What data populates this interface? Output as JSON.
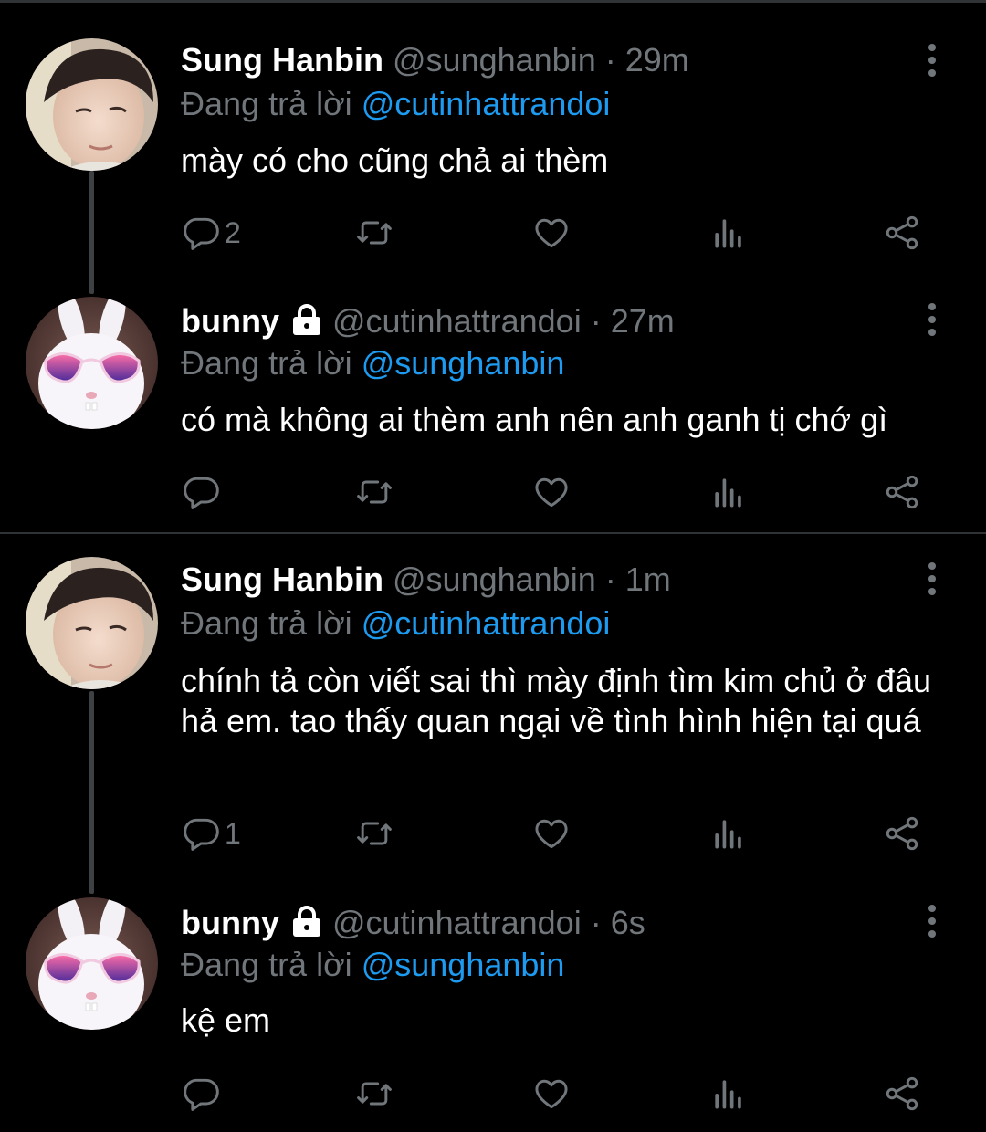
{
  "reply_prefix": "Đang trả lời",
  "colors": {
    "background": "#000000",
    "name": "#ffffff",
    "muted": "#71767b",
    "mention": "#1d9bf0",
    "divider": "#2f3336"
  },
  "tweets": [
    {
      "name": "Sung Hanbin",
      "handle": "@sunghanbin",
      "separator": "·",
      "time": "29m",
      "locked": false,
      "avatar": "man-avatar",
      "reply_to": "@cutinhattrandoi",
      "text": "mày có cho cũng chả ai thèm",
      "reply_count": "2"
    },
    {
      "name": "bunny",
      "handle": "@cutinhattrandoi",
      "separator": "·",
      "time": "27m",
      "locked": true,
      "avatar": "bunny-avatar",
      "reply_to": "@sunghanbin",
      "text": "có mà không ai thèm anh nên anh ganh tị chớ gì",
      "reply_count": ""
    },
    {
      "name": "Sung Hanbin",
      "handle": "@sunghanbin",
      "separator": "·",
      "time": "1m",
      "locked": false,
      "avatar": "man-avatar",
      "reply_to": "@cutinhattrandoi",
      "text": "chính tả còn viết sai thì mày định tìm kim chủ ở đâu hả em. tao thấy quan ngại về tình hình hiện tại quá",
      "reply_count": "1"
    },
    {
      "name": "bunny",
      "handle": "@cutinhattrandoi",
      "separator": "·",
      "time": "6s",
      "locked": true,
      "avatar": "bunny-avatar",
      "reply_to": "@sunghanbin",
      "text": "kệ em",
      "reply_count": ""
    }
  ],
  "icons": [
    "reply-icon",
    "retweet-icon",
    "like-icon",
    "views-icon",
    "share-icon",
    "more-icon",
    "lock-icon"
  ]
}
